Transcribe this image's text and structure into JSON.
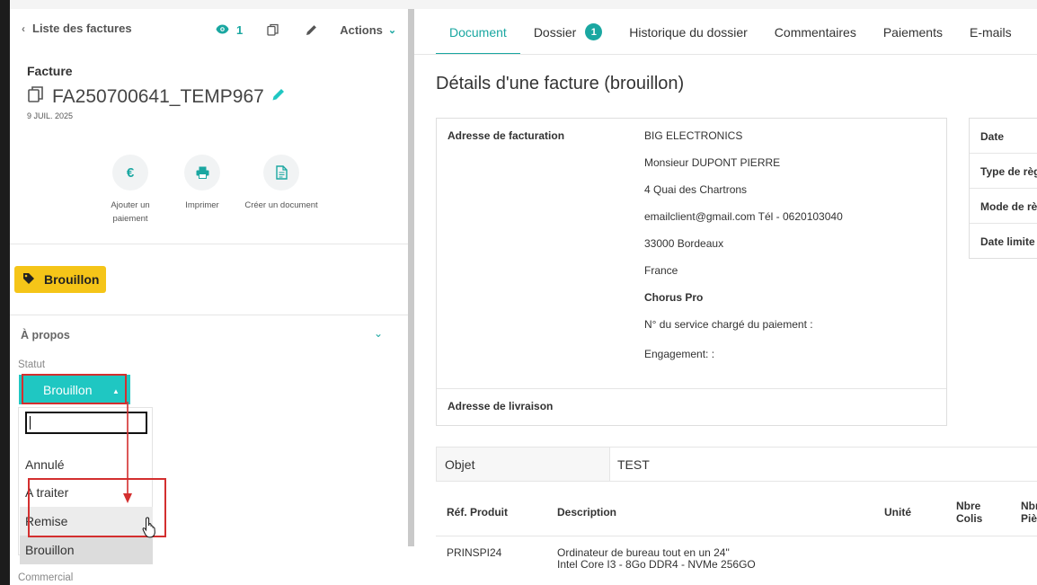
{
  "sidebar": {
    "back_label": "Liste des factures",
    "views_count": "1",
    "actions_label": "Actions",
    "doc_type": "Facture",
    "doc_number": "FA250700641_TEMP967",
    "doc_date": "9 JUIL. 2025",
    "quick_actions": [
      {
        "label_line1": "Ajouter un",
        "label_line2": "paiement",
        "icon": "euro-icon"
      },
      {
        "label_line1": "Imprimer",
        "label_line2": "",
        "icon": "printer-icon"
      },
      {
        "label_line1": "Créer un document",
        "label_line2": "",
        "icon": "document-icon"
      }
    ],
    "draft_badge": "Brouillon",
    "about_label": "À propos",
    "status_label": "Statut",
    "status_value": "Brouillon",
    "status_options": [
      "Annulé",
      "A traiter",
      "Remise",
      "Brouillon"
    ],
    "hovered_option": "Remise",
    "selected_option": "Brouillon",
    "commercial_label": "Commercial"
  },
  "tabs": {
    "document": "Document",
    "dossier": "Dossier",
    "dossier_count": "1",
    "historique": "Historique du dossier",
    "commentaires": "Commentaires",
    "paiements": "Paiements",
    "emails": "E-mails"
  },
  "main": {
    "title": "Détails d'une facture (brouillon)",
    "billing_label": "Adresse de facturation",
    "billing_lines": [
      "BIG ELECTRONICS",
      "Monsieur DUPONT PIERRE",
      "4 Quai des Chartrons",
      "emailclient@gmail.com Tél - 0620103040",
      "33000 Bordeaux",
      "France",
      "Chorus Pro",
      "N° du service chargé du paiement :",
      "Engagement: :"
    ],
    "shipping_label": "Adresse de livraison",
    "info_labels": [
      "Date",
      "Type de règ",
      "Mode de rè",
      "Date limite"
    ],
    "objet_label": "Objet",
    "objet_value": "TEST",
    "columns": {
      "ref": "Réf. Produit",
      "description": "Description",
      "unite": "Unité",
      "colis_1": "Nbre",
      "colis_2": "Colis",
      "pieces_1": "Nbr",
      "pieces_2": "Piè"
    },
    "row": {
      "ref": "PRINSPI24",
      "desc_line1": "Ordinateur de bureau tout en un 24\"",
      "desc_line2": "Intel Core I3 - 8Go DDR4 - NVMe 256GO"
    }
  },
  "colors": {
    "accent": "#1aa7a1",
    "status_select": "#1fc7c2",
    "badge_yellow": "#f5c518",
    "annotation_red": "#d32f2f"
  }
}
